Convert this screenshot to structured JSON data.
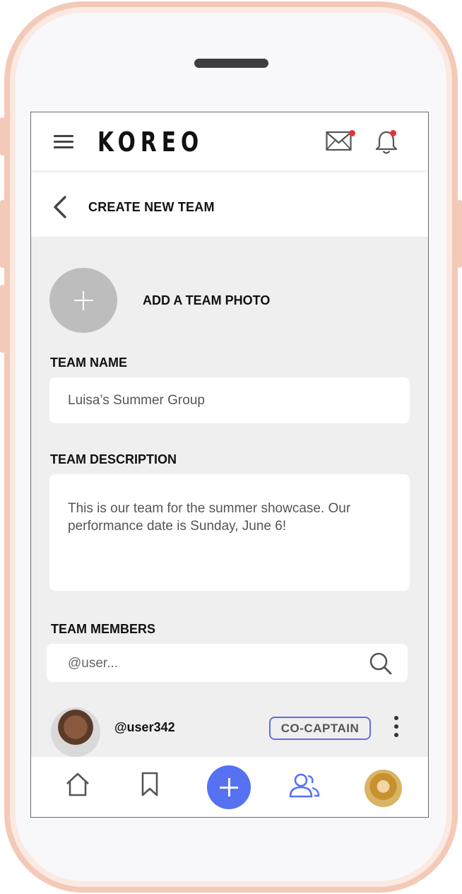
{
  "app": {
    "logo": "KOREO",
    "accent_color": "#5672f2",
    "notification_color": "#e8323b"
  },
  "topbar": {
    "menu_icon": "hamburger-icon",
    "messages_icon": "envelope-icon",
    "notifications_icon": "bell-icon"
  },
  "header": {
    "title": "CREATE NEW TEAM",
    "back_icon": "chevron-left-icon"
  },
  "photo": {
    "label": "ADD A TEAM PHOTO",
    "icon": "plus-icon"
  },
  "team_name": {
    "label": "TEAM NAME",
    "value": "Luisa’s Summer Group"
  },
  "team_description": {
    "label": "TEAM DESCRIPTION",
    "value": "This is our team for the summer showcase. Our performance date is Sunday, June 6!"
  },
  "team_members": {
    "label": "TEAM MEMBERS",
    "search_placeholder": "@user...",
    "members": [
      {
        "handle": "@user342",
        "role": "CO-CAPTAIN"
      }
    ]
  },
  "bottom_nav": {
    "items": [
      "home-icon",
      "bookmark-icon",
      "create-plus-icon",
      "team-icon",
      "profile-avatar"
    ],
    "active": "team-icon"
  }
}
